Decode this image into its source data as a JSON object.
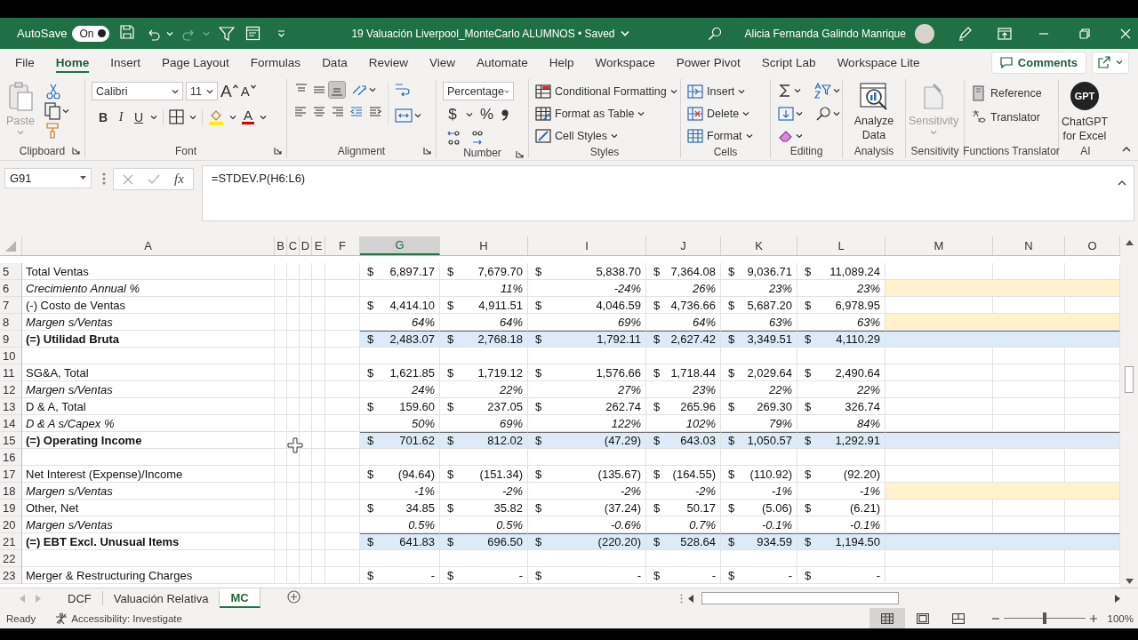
{
  "title_bar": {
    "autosave_label": "AutoSave",
    "autosave_toggle": {
      "label": "On",
      "on": true
    },
    "document_title": "19 Valuación Liverpool_MonteCarlo ALUMNOS • Saved",
    "user_name": "Alicia Fernanda Galindo Manrique"
  },
  "menu_tabs": [
    {
      "label": "File",
      "selected": false
    },
    {
      "label": "Home",
      "selected": true
    },
    {
      "label": "Insert",
      "selected": false
    },
    {
      "label": "Page Layout",
      "selected": false
    },
    {
      "label": "Formulas",
      "selected": false
    },
    {
      "label": "Data",
      "selected": false
    },
    {
      "label": "Review",
      "selected": false
    },
    {
      "label": "View",
      "selected": false
    },
    {
      "label": "Automate",
      "selected": false
    },
    {
      "label": "Help",
      "selected": false
    },
    {
      "label": "Workspace",
      "selected": false
    },
    {
      "label": "Power Pivot",
      "selected": false
    },
    {
      "label": "Script Lab",
      "selected": false
    },
    {
      "label": "Workspace Lite",
      "selected": false
    }
  ],
  "comments_button": "Comments",
  "ribbon": [
    {
      "kind": "clipboard",
      "label": "Clipboard",
      "paste": {
        "label": "Paste",
        "disabled": true
      }
    },
    {
      "kind": "font",
      "label": "Font",
      "font_name": "Calibri",
      "font_size": "11",
      "grow": "A",
      "shrink": "A",
      "bold": "B",
      "italic": "I",
      "underline": "U",
      "font_color": "A"
    },
    {
      "kind": "alignment",
      "label": "Alignment",
      "vertical_align": [
        {
          "selected": false
        },
        {
          "selected": false
        },
        {
          "selected": true
        }
      ]
    },
    {
      "kind": "number",
      "label": "Number",
      "format": "Percentage",
      "currency": "$",
      "percent": "%"
    },
    {
      "kind": "styles",
      "label": "Styles",
      "items": [
        "Conditional Formatting",
        "Format as Table",
        "Cell Styles"
      ]
    },
    {
      "kind": "cells",
      "label": "Cells",
      "items": [
        "Insert",
        "Delete",
        "Format"
      ]
    },
    {
      "kind": "editing",
      "label": "Editing"
    },
    {
      "kind": "analysis",
      "label": "Analysis",
      "button": "Analyze Data"
    },
    {
      "kind": "sensitivity",
      "label": "Sensitivity",
      "button": "Sensitivity",
      "disabled": true
    },
    {
      "kind": "translator",
      "label": "Functions Translator",
      "items": [
        "Reference",
        "Translator"
      ]
    },
    {
      "kind": "ai",
      "label": "AI",
      "logo": "GPT",
      "button": "ChatGPT for Excel"
    }
  ],
  "formula_bar": {
    "name_box": "G91",
    "function_label": "fx",
    "formula": "=STDEV.P(H6:L6)"
  },
  "columns": [
    {
      "label": "A",
      "selected": false
    },
    {
      "label": "B",
      "selected": false
    },
    {
      "label": "C",
      "selected": false
    },
    {
      "label": "D",
      "selected": false
    },
    {
      "label": "E",
      "selected": false
    },
    {
      "label": "F",
      "selected": false
    },
    {
      "label": "G",
      "selected": true
    },
    {
      "label": "H",
      "selected": false
    },
    {
      "label": "I",
      "selected": false
    },
    {
      "label": "J",
      "selected": false
    },
    {
      "label": "K",
      "selected": false
    },
    {
      "label": "L",
      "selected": false
    },
    {
      "label": "M",
      "selected": false
    },
    {
      "label": "N",
      "selected": false
    },
    {
      "label": "O",
      "selected": false
    }
  ],
  "rows": [
    {
      "number": "5",
      "kind": "line",
      "label": "Total Ventas",
      "highlighted": false,
      "cells": [
        {
          "symbol": "$",
          "value": "6,897.17"
        },
        {
          "symbol": "$",
          "value": "7,679.70"
        },
        {
          "symbol": "$",
          "value": "5,838.70"
        },
        {
          "symbol": "$",
          "value": "7,364.08"
        },
        {
          "symbol": "$",
          "value": "9,036.71"
        },
        {
          "symbol": "$",
          "value": "11,089.24"
        }
      ]
    },
    {
      "number": "6",
      "kind": "ratio",
      "label": "Crecimiento Annual %",
      "highlighted": true,
      "cells": [
        {},
        {
          "value": "11%"
        },
        {
          "value": "-24%"
        },
        {
          "value": "26%"
        },
        {
          "value": "23%"
        },
        {
          "value": "23%"
        }
      ]
    },
    {
      "number": "7",
      "kind": "line",
      "label": "(-) Costo de Ventas",
      "highlighted": false,
      "cells": [
        {
          "symbol": "$",
          "value": "4,414.10"
        },
        {
          "symbol": "$",
          "value": "4,911.51"
        },
        {
          "symbol": "$",
          "value": "4,046.59"
        },
        {
          "symbol": "$",
          "value": "4,736.66"
        },
        {
          "symbol": "$",
          "value": "5,687.20"
        },
        {
          "symbol": "$",
          "value": "6,978.95"
        }
      ]
    },
    {
      "number": "8",
      "kind": "ratio",
      "label": "Margen s/Ventas",
      "highlighted": true,
      "cells": [
        {
          "value": "64%"
        },
        {
          "value": "64%"
        },
        {
          "value": "69%"
        },
        {
          "value": "64%"
        },
        {
          "value": "63%"
        },
        {
          "value": "63%"
        }
      ]
    },
    {
      "number": "9",
      "kind": "total",
      "label": "(=) Utilidad Bruta",
      "highlighted": false,
      "cells": [
        {
          "symbol": "$",
          "value": "2,483.07"
        },
        {
          "symbol": "$",
          "value": "2,768.18"
        },
        {
          "symbol": "$",
          "value": "1,792.11"
        },
        {
          "symbol": "$",
          "value": "2,627.42"
        },
        {
          "symbol": "$",
          "value": "3,349.51"
        },
        {
          "symbol": "$",
          "value": "4,110.29"
        }
      ]
    },
    {
      "number": "10",
      "kind": "blank",
      "highlighted": false
    },
    {
      "number": "11",
      "kind": "line",
      "label": "SG&A, Total",
      "highlighted": false,
      "cells": [
        {
          "symbol": "$",
          "value": "1,621.85"
        },
        {
          "symbol": "$",
          "value": "1,719.12"
        },
        {
          "symbol": "$",
          "value": "1,576.66"
        },
        {
          "symbol": "$",
          "value": "1,718.44"
        },
        {
          "symbol": "$",
          "value": "2,029.64"
        },
        {
          "symbol": "$",
          "value": "2,490.64"
        }
      ]
    },
    {
      "number": "12",
      "kind": "ratio",
      "label": "Margen s/Ventas",
      "highlighted": false,
      "cells": [
        {
          "value": "24%"
        },
        {
          "value": "22%"
        },
        {
          "value": "27%"
        },
        {
          "value": "23%"
        },
        {
          "value": "22%"
        },
        {
          "value": "22%"
        }
      ]
    },
    {
      "number": "13",
      "kind": "line",
      "label": "D & A, Total",
      "highlighted": false,
      "cells": [
        {
          "symbol": "$",
          "value": "159.60"
        },
        {
          "symbol": "$",
          "value": "237.05"
        },
        {
          "symbol": "$",
          "value": "262.74"
        },
        {
          "symbol": "$",
          "value": "265.96"
        },
        {
          "symbol": "$",
          "value": "269.30"
        },
        {
          "symbol": "$",
          "value": "326.74"
        }
      ]
    },
    {
      "number": "14",
      "kind": "ratio",
      "label": "D & A s/Capex %",
      "highlighted": false,
      "cells": [
        {
          "value": "50%"
        },
        {
          "value": "69%"
        },
        {
          "value": "122%"
        },
        {
          "value": "102%"
        },
        {
          "value": "79%"
        },
        {
          "value": "84%"
        }
      ]
    },
    {
      "number": "15",
      "kind": "total",
      "label": "(=) Operating Income",
      "highlighted": false,
      "cells": [
        {
          "symbol": "$",
          "value": "701.62"
        },
        {
          "symbol": "$",
          "value": "812.02"
        },
        {
          "symbol": "$",
          "value": "(47.29)"
        },
        {
          "symbol": "$",
          "value": "643.03"
        },
        {
          "symbol": "$",
          "value": "1,050.57"
        },
        {
          "symbol": "$",
          "value": "1,292.91"
        }
      ]
    },
    {
      "number": "16",
      "kind": "blank",
      "highlighted": false
    },
    {
      "number": "17",
      "kind": "line",
      "label": "Net Interest (Expense)/Income",
      "highlighted": false,
      "cells": [
        {
          "symbol": "$",
          "value": "(94.64)"
        },
        {
          "symbol": "$",
          "value": "(151.34)"
        },
        {
          "symbol": "$",
          "value": "(135.67)"
        },
        {
          "symbol": "$",
          "value": "(164.55)"
        },
        {
          "symbol": "$",
          "value": "(110.92)"
        },
        {
          "symbol": "$",
          "value": "(92.20)"
        }
      ]
    },
    {
      "number": "18",
      "kind": "ratio",
      "label": "Margen s/Ventas",
      "highlighted": true,
      "cells": [
        {
          "value": "-1%"
        },
        {
          "value": "-2%"
        },
        {
          "value": "-2%"
        },
        {
          "value": "-2%"
        },
        {
          "value": "-1%"
        },
        {
          "value": "-1%"
        }
      ]
    },
    {
      "number": "19",
      "kind": "line",
      "label": "Other, Net",
      "highlighted": false,
      "cells": [
        {
          "symbol": "$",
          "value": "34.85"
        },
        {
          "symbol": "$",
          "value": "35.82"
        },
        {
          "symbol": "$",
          "value": "(37.24)"
        },
        {
          "symbol": "$",
          "value": "50.17"
        },
        {
          "symbol": "$",
          "value": "(5.06)"
        },
        {
          "symbol": "$",
          "value": "(6.21)"
        }
      ]
    },
    {
      "number": "20",
      "kind": "ratio",
      "label": "Margen s/Ventas",
      "highlighted": false,
      "cells": [
        {
          "value": "0.5%"
        },
        {
          "value": "0.5%"
        },
        {
          "value": "-0.6%"
        },
        {
          "value": "0.7%"
        },
        {
          "value": "-0.1%"
        },
        {
          "value": "-0.1%"
        }
      ]
    },
    {
      "number": "21",
      "kind": "total",
      "label": "(=) EBT Excl. Unusual Items",
      "highlighted": false,
      "cells": [
        {
          "symbol": "$",
          "value": "641.83"
        },
        {
          "symbol": "$",
          "value": "696.50"
        },
        {
          "symbol": "$",
          "value": "(220.20)"
        },
        {
          "symbol": "$",
          "value": "528.64"
        },
        {
          "symbol": "$",
          "value": "934.59"
        },
        {
          "symbol": "$",
          "value": "1,194.50"
        }
      ]
    },
    {
      "number": "22",
      "kind": "blank",
      "highlighted": false
    },
    {
      "number": "23",
      "kind": "line",
      "label": "Merger & Restructuring Charges",
      "highlighted": false,
      "cells": [
        {
          "symbol": "$",
          "value": "-"
        },
        {
          "symbol": "$",
          "value": "-"
        },
        {
          "symbol": "$",
          "value": "-"
        },
        {
          "symbol": "$",
          "value": "-"
        },
        {
          "symbol": "$",
          "value": "-"
        },
        {
          "symbol": "$",
          "value": "-"
        }
      ]
    }
  ],
  "sheet_tabs": [
    {
      "label": "DCF",
      "selected": false
    },
    {
      "label": "Valuación Relativa",
      "selected": false
    },
    {
      "label": "MC",
      "selected": true
    }
  ],
  "status_bar": {
    "mode": "Ready",
    "accessibility": "Accessibility: Investigate",
    "zoom": {
      "level": 0.5,
      "reading": "100%"
    }
  }
}
